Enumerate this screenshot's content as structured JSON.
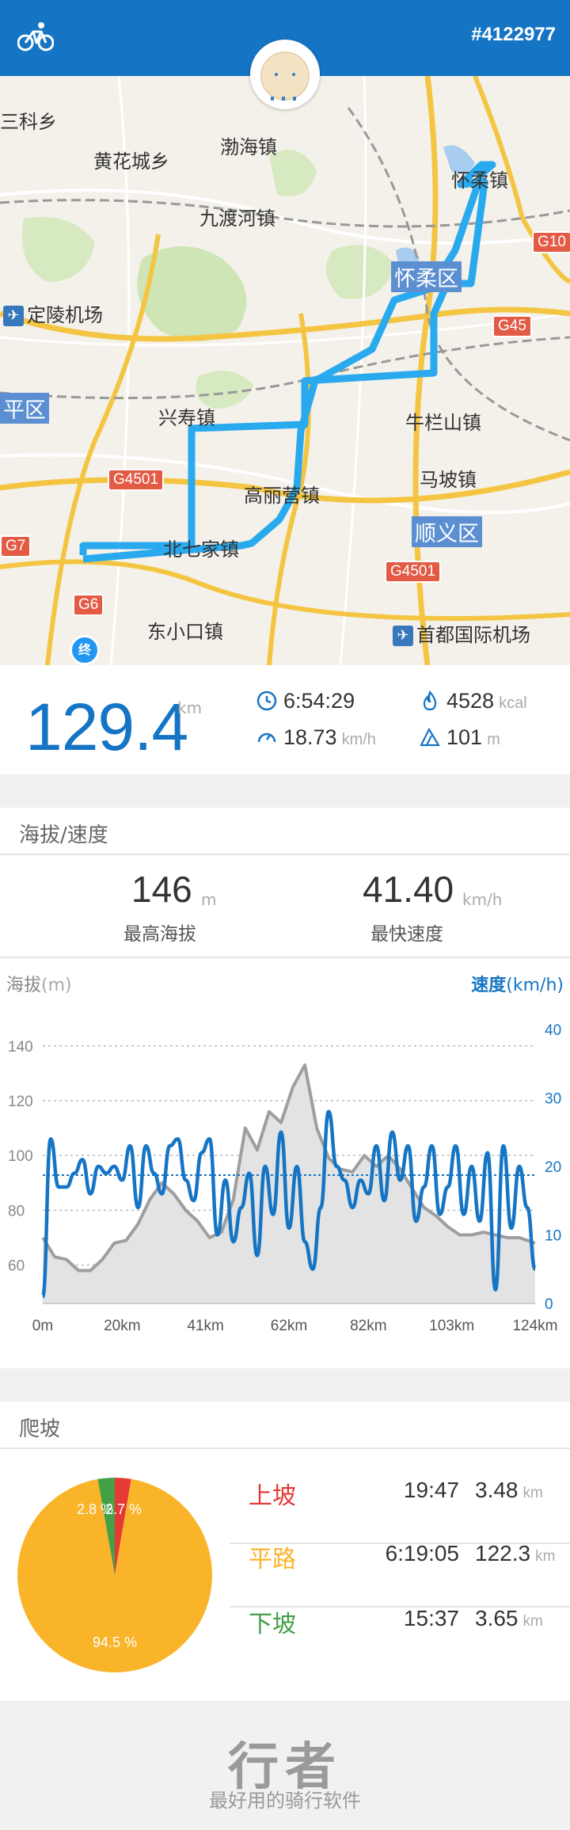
{
  "header": {
    "record_id": "#4122977",
    "bg_color": "#1575c4"
  },
  "map": {
    "labels": {
      "kexiang": "三科乡",
      "huanghuacheng": "黄花城乡",
      "bohai": "渤海镇",
      "jiuduhe": "九渡河镇",
      "huairou_town": "怀柔镇",
      "huairou_district": "怀柔区",
      "dingling": "定陵机场",
      "changping": "平区",
      "xingshou": "兴寿镇",
      "niulanshan": "牛栏山镇",
      "mapo": "马坡镇",
      "gaoliying": "高丽营镇",
      "shunyi": "顺义区",
      "beiqijia": "北七家镇",
      "xiaokou": "东小口镇",
      "capital_airport": "首都国际机场"
    },
    "highways": {
      "g10": "G10",
      "g45": "G45",
      "g4501a": "G4501",
      "g4501b": "G4501",
      "g7": "G7",
      "g6": "G6"
    },
    "end_marker": "终",
    "route_color": "#29a9ee"
  },
  "summary": {
    "distance": "129.4",
    "distance_unit": "km",
    "duration": "6:54:29",
    "calories": "4528",
    "calories_unit": "kcal",
    "avg_speed": "18.73",
    "avg_speed_unit": "km/h",
    "climb": "101",
    "climb_unit": "m"
  },
  "altitude_speed": {
    "section_title": "海拔/速度",
    "max_altitude": "146",
    "max_altitude_unit": "m",
    "max_altitude_label": "最高海拔",
    "max_speed": "41.40",
    "max_speed_unit": "km/h",
    "max_speed_label": "最快速度",
    "left_axis_title": "海拔",
    "left_axis_unit": "(m)",
    "right_axis_title": "速度",
    "right_axis_unit": "(km/h)"
  },
  "chart_data": [
    {
      "type": "area",
      "x_ticks": [
        "0m",
        "20km",
        "41km",
        "62km",
        "82km",
        "103km",
        "124km"
      ],
      "x_range_km": [
        0,
        124
      ],
      "y_left_ticks": [
        "140",
        "120",
        "100",
        "80",
        "60"
      ],
      "y_left_range": [
        46,
        146
      ],
      "y_right_ticks": [
        "40",
        "30",
        "20",
        "10",
        "0"
      ],
      "y_right_range": [
        0,
        40
      ],
      "grid": true,
      "avg_speed_line": 18.73,
      "series": [
        {
          "axis": "left",
          "color": "#9e9e9e",
          "x": [
            0,
            3,
            6,
            9,
            12,
            15,
            18,
            21,
            24,
            27,
            30,
            33,
            36,
            39,
            42,
            45,
            48,
            51,
            54,
            57,
            60,
            63,
            66,
            69,
            72,
            75,
            78,
            81,
            84,
            87,
            90,
            93,
            96,
            99,
            102,
            105,
            108,
            111,
            114,
            117,
            120,
            124
          ],
          "values": [
            70,
            63,
            62,
            58,
            58,
            62,
            68,
            69,
            75,
            84,
            90,
            86,
            80,
            76,
            70,
            72,
            84,
            110,
            102,
            116,
            112,
            125,
            133,
            110,
            99,
            95,
            94,
            100,
            96,
            100,
            95,
            88,
            81,
            78,
            74,
            71,
            71,
            72,
            71,
            70,
            70,
            68
          ]
        },
        {
          "axis": "right",
          "color": "#1575c4",
          "x": [
            0,
            2,
            4,
            6,
            8,
            10,
            12,
            14,
            16,
            18,
            20,
            22,
            24,
            26,
            28,
            30,
            32,
            34,
            36,
            38,
            40,
            42,
            44,
            46,
            48,
            50,
            52,
            54,
            56,
            58,
            60,
            62,
            64,
            66,
            68,
            70,
            72,
            74,
            76,
            78,
            80,
            82,
            84,
            86,
            88,
            90,
            92,
            94,
            96,
            98,
            100,
            102,
            104,
            106,
            108,
            110,
            112,
            114,
            116,
            118,
            120,
            122,
            124
          ],
          "values": [
            1,
            24,
            17,
            17,
            19,
            21,
            16,
            20,
            19,
            20,
            18,
            23,
            14,
            23,
            19,
            16,
            23,
            24,
            18,
            15,
            22,
            24,
            10,
            18,
            9,
            14,
            19,
            7,
            20,
            13,
            25,
            11,
            20,
            9,
            5,
            14,
            28,
            20,
            18,
            14,
            18,
            16,
            23,
            15,
            25,
            18,
            23,
            12,
            17,
            23,
            13,
            17,
            23,
            13,
            20,
            12,
            22,
            2,
            23,
            11,
            20,
            14,
            5
          ]
        }
      ]
    },
    {
      "type": "pie",
      "slices": [
        {
          "label": "上坡",
          "value": 2.7,
          "color": "#e53935"
        },
        {
          "label": "下坡",
          "value": 2.8,
          "color": "#43a047"
        },
        {
          "label": "平路",
          "value": 94.5,
          "color": "#f9b42a"
        }
      ],
      "slice_labels": [
        "2.8 %",
        "2.7 %",
        "94.5 %"
      ]
    }
  ],
  "climb": {
    "section_title": "爬坡",
    "rows": [
      {
        "label": "上坡",
        "time": "19:47",
        "distance": "3.48",
        "unit": "km",
        "color": "#e53935"
      },
      {
        "label": "平路",
        "time": "6:19:05",
        "distance": "122.3",
        "unit": "km",
        "color": "#f9b42a"
      },
      {
        "label": "下坡",
        "time": "15:37",
        "distance": "3.65",
        "unit": "km",
        "color": "#43a047"
      }
    ]
  },
  "footer": {
    "logo": "行者",
    "slogan": "最好用的骑行软件"
  }
}
